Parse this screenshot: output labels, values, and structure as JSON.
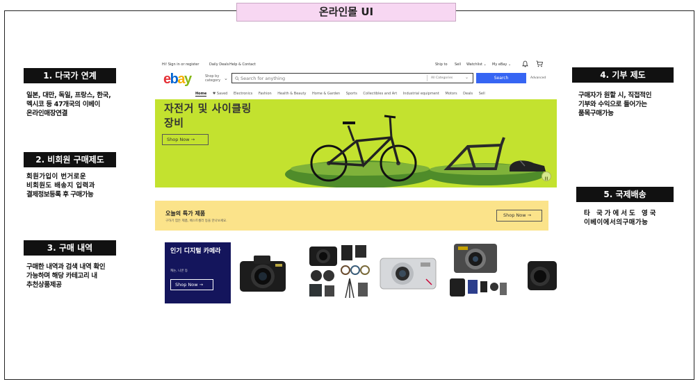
{
  "page": {
    "title": "온라인몰 UI"
  },
  "features": [
    {
      "label": "1. 다국가 연계",
      "desc": [
        "일본, 대만, 독일, 프랑스, 한국,",
        "멕시코 등 47개국의 이베이",
        "온라인매장연결"
      ]
    },
    {
      "label": "2. 비회원 구매제도",
      "desc": [
        "회원가입이 번거로운",
        "비회원도 배송지 입력과",
        "결제정보등록 후 구매가능"
      ]
    },
    {
      "label": "3. 구매 내역",
      "desc": [
        "구매한 내역과 검색 내역 확인",
        "가능하며 해당 카테고리 내",
        "추천상품제공"
      ]
    },
    {
      "label": "4. 기부 제도",
      "desc": [
        "구매자가 원할 시, 직접적인",
        "기부와 수익으로 들어가는",
        "품목구매가능"
      ]
    },
    {
      "label": "5. 국제배송",
      "desc": [
        "타 국가에서도 영국",
        "이베이에서의구매가능"
      ]
    }
  ],
  "ebay": {
    "topbar": {
      "greeting": "Hi! Sign in or register",
      "daily_deals": "Daily Deals",
      "help": "Help & Contact",
      "ship_to": "Ship to",
      "sell": "Sell",
      "watchlist": "Watchlist",
      "my_ebay": "My eBay"
    },
    "logo": {
      "e": "e",
      "b": "b",
      "a": "a",
      "y": "y"
    },
    "shop_by_category": "Shop by category",
    "search": {
      "placeholder": "Search for anything",
      "category": "All Categories",
      "button": "Search",
      "advanced": "Advanced"
    },
    "nav": [
      "Home",
      "♥ Saved",
      "Electronics",
      "Fashion",
      "Health & Beauty",
      "Home & Garden",
      "Sports",
      "Collectibles and Art",
      "Industrial equipment",
      "Motors",
      "Deals",
      "Sell"
    ],
    "hero": {
      "title_line1": "자전거 및 사이클링",
      "title_line2": "장비",
      "button": "Shop Now →"
    },
    "deal": {
      "title": "오늘의 특가 제품",
      "subtitle": "구하기 힘든 제품, 베스트셀러 등을 만나보세요.",
      "button": "Shop Now →"
    },
    "camera": {
      "title": "인기 디지털 카메라",
      "subtitle": "캐논, 니콘 등",
      "button": "Shop Now →"
    }
  },
  "colors": {
    "hero_bg": "#c3e22f",
    "deal_bg": "#fbe38a",
    "camera_bg": "#14155c",
    "search_btn": "#3665f3",
    "title_bg": "#f7d7f2"
  }
}
